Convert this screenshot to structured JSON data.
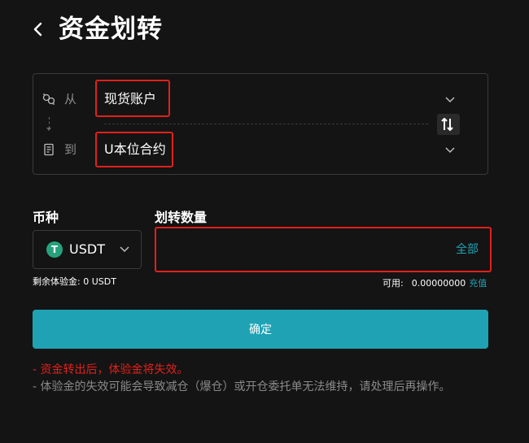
{
  "header": {
    "title": "资金划转"
  },
  "transfer": {
    "from_label": "从",
    "from_account": "现货账户",
    "to_label": "到",
    "to_account": "U本位合约"
  },
  "coin": {
    "label": "币种",
    "value": "USDT",
    "icon_letter": "T"
  },
  "quantity": {
    "label": "划转数量",
    "value": "",
    "all_label": "全部"
  },
  "balance": {
    "trial_text": "剩余体验金: 0 USDT",
    "available_label": "可用:",
    "available_value": "0.00000000",
    "deposit_link": "充值"
  },
  "confirm_label": "确定",
  "notes": {
    "warning": "- 资金转出后，体验金将失效。",
    "info": "- 体验金的失效可能会导致减仓（爆仓）或开仓委托单无法维持，请处理后再操作。"
  },
  "colors": {
    "accent": "#1fa3b4",
    "highlight_frame": "#e0211b",
    "usdt_green": "#26a17b"
  },
  "icons": {
    "back": "chevron-left-icon",
    "from": "wallet-link-icon",
    "to": "contract-icon",
    "dropdown": "chevron-down-icon",
    "swap": "swap-icon",
    "coin": "usdt-icon"
  }
}
